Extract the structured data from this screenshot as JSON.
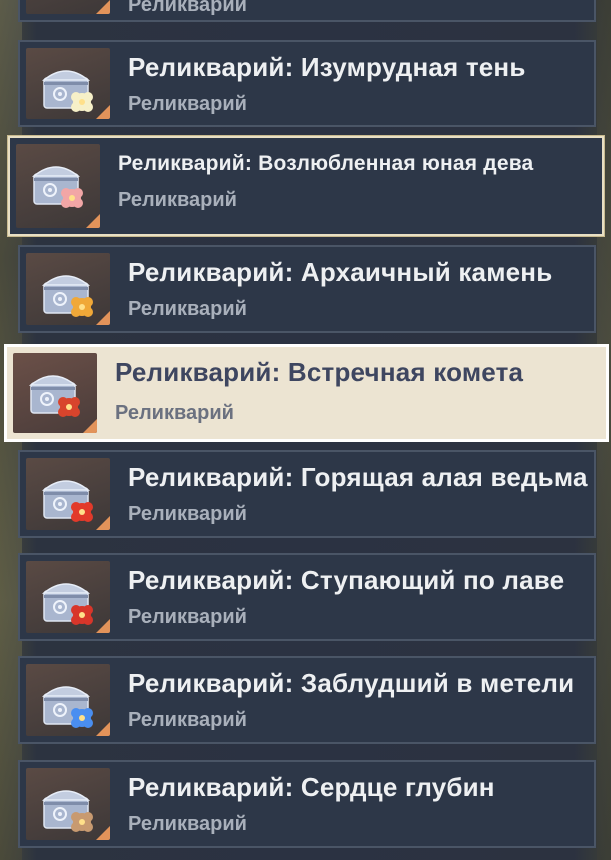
{
  "accent_colors": {
    "row_bg": "#2d3748",
    "selected_border": "#e8dfc4",
    "hovered_bg": "#ece4d2",
    "corner": "#e2935a"
  },
  "partial_top": {
    "title": "Реликварий: Изумрудная тень",
    "subtitle": "Реликварий"
  },
  "items": [
    {
      "title": "Реликварий: Изумрудная тень",
      "subtitle": "Реликварий",
      "flower_color": "#f6f0c8",
      "icon": "chest-icon"
    },
    {
      "title": "Реликварий: Возлюбленная юная дева",
      "subtitle": "Реликварий",
      "flower_color": "#f2a6a6",
      "icon": "chest-icon"
    },
    {
      "title": "Реликварий: Архаичный камень",
      "subtitle": "Реликварий",
      "flower_color": "#f0a838",
      "icon": "chest-icon"
    },
    {
      "title": "Реликварий: Встречная комета",
      "subtitle": "Реликварий",
      "flower_color": "#d8442c",
      "icon": "chest-icon"
    },
    {
      "title": "Реликварий: Горящая алая ведьма",
      "subtitle": "Реликварий",
      "flower_color": "#e23a2a",
      "icon": "chest-icon"
    },
    {
      "title": "Реликварий: Ступающий по лаве",
      "subtitle": "Реликварий",
      "flower_color": "#d8362a",
      "icon": "chest-icon"
    },
    {
      "title": "Реликварий: Заблудший в метели",
      "subtitle": "Реликварий",
      "flower_color": "#4a8ef0",
      "icon": "chest-icon"
    },
    {
      "title": "Реликварий: Сердце глубин",
      "subtitle": "Реликварий",
      "flower_color": "#c89a70",
      "icon": "chest-icon"
    }
  ]
}
